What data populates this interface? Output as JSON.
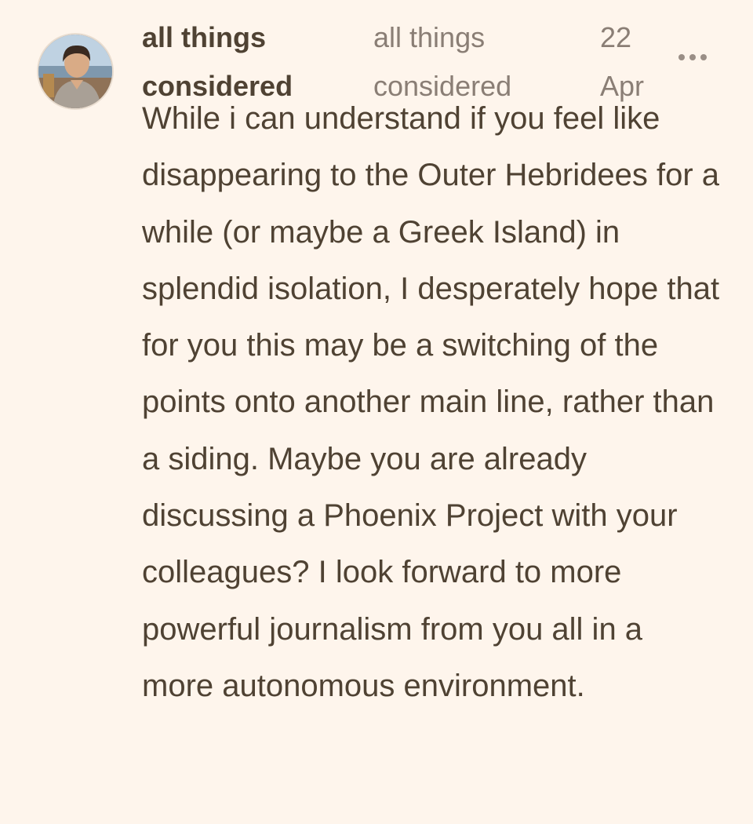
{
  "comment": {
    "author": {
      "name": "all things considered",
      "avatar_icon": "user-avatar-photo"
    },
    "publication": "all things considered",
    "date": "22 Apr",
    "more_icon": "more-options-icon",
    "body": "While i can understand if you feel like disappearing to the Outer Hebridees for a while (or maybe a Greek Island) in splendid isolation, I desperately hope that for you this may be a switching of the points onto another main line, rather than a siding. Maybe you are already discussing a Phoenix Project with your colleagues? I look forward to more powerful journalism from you all in a more autonomous environment."
  },
  "colors": {
    "background": "#fef5ec",
    "text_primary": "#4f4233",
    "text_muted": "#8a7e75",
    "icon": "#9a8e86"
  }
}
